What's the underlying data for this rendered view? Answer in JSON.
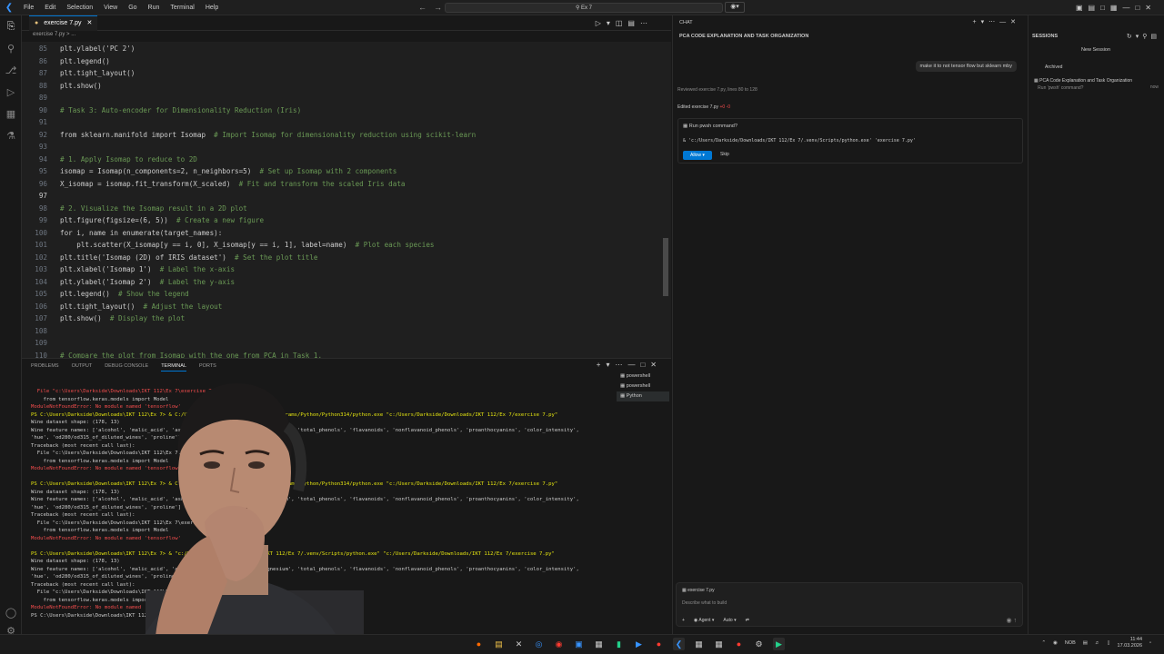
{
  "titlebar": {
    "menu": [
      "File",
      "Edit",
      "Selection",
      "View",
      "Go",
      "Run",
      "Terminal",
      "Help"
    ],
    "search": "Ex 7"
  },
  "editor": {
    "tab_label": "exercise 7.py",
    "breadcrumb": "exercise 7.py > ...",
    "lines": [
      {
        "n": "85",
        "code": "plt.ylabel('PC 2')"
      },
      {
        "n": "86",
        "code": "plt.legend()"
      },
      {
        "n": "87",
        "code": "plt.tight_layout()"
      },
      {
        "n": "88",
        "code": "plt.show()"
      },
      {
        "n": "89",
        "code": ""
      },
      {
        "n": "90",
        "code": "# Task 3: Auto-encoder for Dimensionality Reduction (Iris)"
      },
      {
        "n": "91",
        "code": ""
      },
      {
        "n": "92",
        "code": "from sklearn.manifold import Isomap  # Import Isomap for dimensionality reduction using scikit-learn"
      },
      {
        "n": "93",
        "code": ""
      },
      {
        "n": "94",
        "code": "# 1. Apply Isomap to reduce to 2D"
      },
      {
        "n": "95",
        "code": "isomap = Isomap(n_components=2, n_neighbors=5)  # Set up Isomap with 2 components"
      },
      {
        "n": "96",
        "code": "X_isomap = isomap.fit_transform(X_scaled)  # Fit and transform the scaled Iris data"
      },
      {
        "n": "97",
        "code": ""
      },
      {
        "n": "98",
        "code": "# 2. Visualize the Isomap result in a 2D plot"
      },
      {
        "n": "99",
        "code": "plt.figure(figsize=(6, 5))  # Create a new figure"
      },
      {
        "n": "100",
        "code": "for i, name in enumerate(target_names):"
      },
      {
        "n": "101",
        "code": "    plt.scatter(X_isomap[y == i, 0], X_isomap[y == i, 1], label=name)  # Plot each species"
      },
      {
        "n": "102",
        "code": "plt.title('Isomap (2D) of IRIS dataset')  # Set the plot title"
      },
      {
        "n": "103",
        "code": "plt.xlabel('Isomap 1')  # Label the x-axis"
      },
      {
        "n": "104",
        "code": "plt.ylabel('Isomap 2')  # Label the y-axis"
      },
      {
        "n": "105",
        "code": "plt.legend()  # Show the legend"
      },
      {
        "n": "106",
        "code": "plt.tight_layout()  # Adjust the layout"
      },
      {
        "n": "107",
        "code": "plt.show()  # Display the plot"
      },
      {
        "n": "108",
        "code": ""
      },
      {
        "n": "109",
        "code": ""
      },
      {
        "n": "110",
        "code": "# Compare the plot from Isomap with the one from PCA in Task 1."
      }
    ]
  },
  "panel": {
    "tabs": [
      "PROBLEMS",
      "OUTPUT",
      "DEBUG CONSOLE",
      "TERMINAL",
      "PORTS"
    ],
    "terminals": [
      "powershell",
      "powershell",
      "Python"
    ],
    "terminal_lines": [
      {
        "t": "  File \"c:\\Users\\Darkside\\Downloads\\IKT 112\\Ex 7\\exercise 7.py\", line 1...",
        "c": "red"
      },
      {
        "t": "    from tensorflow.keras.models import Model",
        "c": ""
      },
      {
        "t": "ModuleNotFoundError: No module named 'tensorflow'",
        "c": "red"
      },
      {
        "t": "PS C:\\Users\\Darkside\\Downloads\\IKT 112\\Ex 7> & C:/Users/Darkside/AppData/Local/Programs/Python/Python314/python.exe \"c:/Users/Darkside/Downloads/IKT 112/Ex 7/exercise 7.py\"",
        "c": "yel"
      },
      {
        "t": "Wine dataset shape: (178, 13)",
        "c": ""
      },
      {
        "t": "Wine feature names: ['alcohol', 'malic_acid', 'ash', 'alcalinity_of_ash', 'magnesium', 'total_phenols', 'flavanoids', 'nonflavanoid_phenols', 'proanthocyanins', 'color_intensity',",
        "c": ""
      },
      {
        "t": "'hue', 'od280/od315_of_diluted_wines', 'proline']",
        "c": ""
      },
      {
        "t": "Traceback (most recent call last):",
        "c": ""
      },
      {
        "t": "  File \"c:\\Users\\Darkside\\Downloads\\IKT 112\\Ex 7\\exercise 7.py\", line ...",
        "c": ""
      },
      {
        "t": "    from tensorflow.keras.models import Model",
        "c": ""
      },
      {
        "t": "ModuleNotFoundError: No module named 'tensorflow'",
        "c": "red"
      },
      {
        "t": "",
        "c": ""
      },
      {
        "t": "PS C:\\Users\\Darkside\\Downloads\\IKT 112\\Ex 7> & C:/Users/Darkside/AppData/Local/Programs/Python/Python314/python.exe \"c:/Users/Darkside/Downloads/IKT 112/Ex 7/exercise 7.py\"",
        "c": "yel"
      },
      {
        "t": "Wine dataset shape: (178, 13)",
        "c": ""
      },
      {
        "t": "Wine feature names: ['alcohol', 'malic_acid', 'ash', 'alcalinity_of_ash', 'magnesium', 'total_phenols', 'flavanoids', 'nonflavanoid_phenols', 'proanthocyanins', 'color_intensity',",
        "c": ""
      },
      {
        "t": "'hue', 'od280/od315_of_diluted_wines', 'proline']",
        "c": ""
      },
      {
        "t": "Traceback (most recent call last):",
        "c": ""
      },
      {
        "t": "  File \"c:\\Users\\Darkside\\Downloads\\IKT 112\\Ex 7\\exercise 7.py\", line ...",
        "c": ""
      },
      {
        "t": "    from tensorflow.keras.models import Model",
        "c": ""
      },
      {
        "t": "ModuleNotFoundError: No module named 'tensorflow'",
        "c": "red"
      },
      {
        "t": "",
        "c": ""
      },
      {
        "t": "PS C:\\Users\\Darkside\\Downloads\\IKT 112\\Ex 7> & \"c:/Users/Darkside/Downloads/IKT 112/Ex 7/.venv/Scripts/python.exe\" \"c:/Users/Darkside/Downloads/IKT 112/Ex 7/exercise 7.py\"",
        "c": "yel"
      },
      {
        "t": "Wine dataset shape: (178, 13)",
        "c": ""
      },
      {
        "t": "Wine feature names: ['alcohol', 'malic_acid', 'ash', 'alcalinity_of_ash', 'magnesium', 'total_phenols', 'flavanoids', 'nonflavanoid_phenols', 'proanthocyanins', 'color_intensity',",
        "c": ""
      },
      {
        "t": "'hue', 'od280/od315_of_diluted_wines', 'proline']",
        "c": ""
      },
      {
        "t": "Traceback (most recent call last):",
        "c": ""
      },
      {
        "t": "  File \"c:\\Users\\Darkside\\Downloads\\IKT 112\\Ex 7\\exercise 7.py\", line ...",
        "c": ""
      },
      {
        "t": "    from tensorflow.keras.models import Model",
        "c": ""
      },
      {
        "t": "ModuleNotFoundError: No module named 'tensorflow'",
        "c": "red"
      },
      {
        "t": "PS C:\\Users\\Darkside\\Downloads\\IKT 112\\Ex 7>",
        "c": ""
      }
    ]
  },
  "chat": {
    "header": "CHAT",
    "title": "PCA CODE EXPLANATION AND TASK ORGANIZATION",
    "user_message": "make it to not tensor flow but sklearn mby",
    "reviewed_label": "Reviewed",
    "reviewed_file": "exercise 7.py, lines 80 to 128",
    "edited_label": "Edited",
    "edited_file": "exercise 7.py",
    "edited_diff": "+0 -0",
    "confirm_title": "Run pwsh command?",
    "confirm_cmd": "& 'c:/Users/Darkside/Downloads/IKT 112/Ex 7/.venv/Scripts/python.exe' 'exercise 7.py'",
    "allow_label": "Allow",
    "skip_label": "Skip",
    "input_chip": "exercise 7.py",
    "input_placeholder": "Describe what to build",
    "mode_label": "Agent",
    "model_label": "Auto"
  },
  "sessions": {
    "title": "SESSIONS",
    "new_session": "New Session",
    "archived": "Archived",
    "item_title": "PCA Code Explanation and Task Organization",
    "item_sub": "Run 'pwsh' command?",
    "item_time": "now"
  },
  "taskbar": {
    "lang": "NOB",
    "time": "11:44",
    "date": "17.03.2026"
  }
}
